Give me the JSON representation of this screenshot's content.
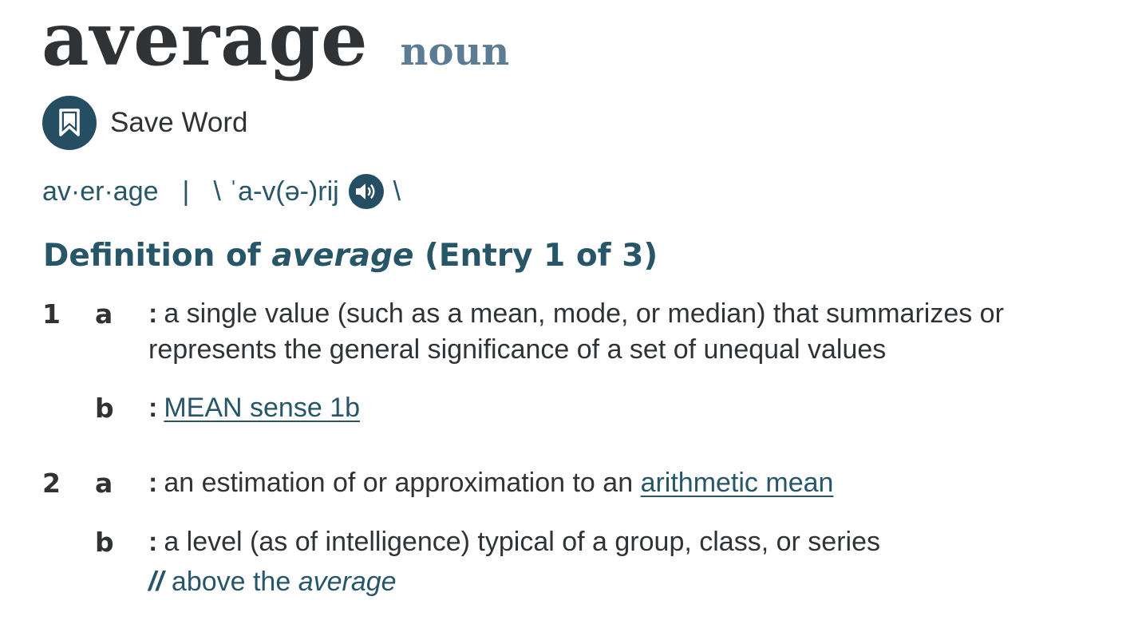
{
  "entry": {
    "headword": "average",
    "part_of_speech": "noun"
  },
  "save": {
    "label": "Save Word",
    "icon": "bookmark-icon"
  },
  "pronunciation": {
    "syllables": "av·er·age",
    "separator": "|",
    "open_slash": "\\",
    "ipa": "ˈa-v(ə-)rij",
    "close_slash": "\\",
    "audio_icon": "speaker-icon"
  },
  "definition_heading": {
    "prefix": "Definition of",
    "word": "average",
    "entry": "(Entry 1 of 3)"
  },
  "senses": [
    {
      "number": "1",
      "subsenses": [
        {
          "letter": "a",
          "colon": ":",
          "text": "a single value (such as a mean, mode, or median) that summarizes or represents the general significance of a set of unequal values"
        },
        {
          "letter": "b",
          "colon": ":",
          "link": "MEAN sense 1b"
        }
      ]
    },
    {
      "number": "2",
      "subsenses": [
        {
          "letter": "a",
          "colon": ":",
          "text": "an estimation of or approximation to an",
          "link": "arithmetic mean"
        },
        {
          "letter": "b",
          "colon": ":",
          "text": "a level (as of intelligence) typical of a group, class, or series",
          "example_mark": "//",
          "example_text": "above the",
          "example_word": "average"
        }
      ]
    }
  ]
}
